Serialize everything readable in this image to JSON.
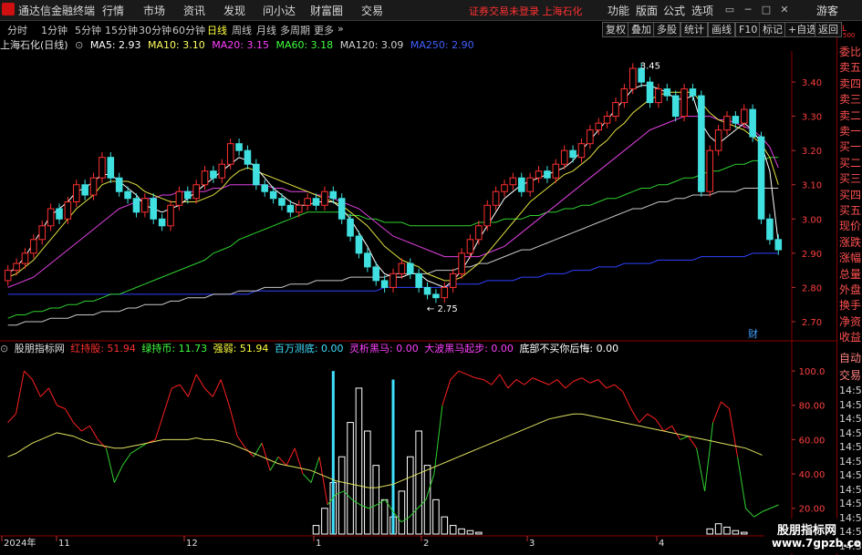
{
  "app": {
    "title": "通达信金融终端"
  },
  "menu": [
    "行情",
    "市场",
    "资讯",
    "发现",
    "问小达",
    "财富圈",
    "交易"
  ],
  "notice": "证券交易未登录  上海石化",
  "right_menu": [
    "功能",
    "版面",
    "公式",
    "选项"
  ],
  "guest": "游客",
  "window_buttons": [
    "▭",
    "─",
    "□",
    "✕"
  ],
  "periods": [
    "分时",
    "1分钟",
    "5分钟",
    "15分钟",
    "30分钟",
    "60分钟",
    "日线",
    "周线",
    "月线",
    "多周期",
    "更多"
  ],
  "active_period": "日线",
  "toolbar": [
    "复权",
    "叠加",
    "多股",
    "统计",
    "画线",
    "F10",
    "标记",
    "+自选",
    "返回"
  ],
  "stock_title": "上海石化(日线)",
  "ma_legend": [
    {
      "label": "MA5: 2.93",
      "color": "#ffffff"
    },
    {
      "label": "MA10: 3.10",
      "color": "#ffff60"
    },
    {
      "label": "MA20: 3.15",
      "color": "#ff40ff"
    },
    {
      "label": "MA60: 3.18",
      "color": "#40ff40"
    },
    {
      "label": "MA120: 3.09",
      "color": "#d0d0d0"
    },
    {
      "label": "MA250: 2.90",
      "color": "#4060ff"
    }
  ],
  "right_panel": [
    "委比",
    "卖五",
    "卖四",
    "卖三",
    "卖二",
    "卖一",
    "买一",
    "买二",
    "买三",
    "买四",
    "买五",
    "现价",
    "涨跌",
    "涨幅",
    "总量",
    "外盘",
    "换手",
    "净资",
    "收益"
  ],
  "right_panel_bottom": [
    "自动",
    "交易"
  ],
  "time_labels": [
    "14:56",
    "14:56",
    "14:56",
    "14:56",
    "14:56",
    "14:56",
    "14:56",
    "14:56",
    "14:56",
    "14:56",
    "14:56",
    "14:56"
  ],
  "badge": "财",
  "mini_mark": [
    "L",
    "500"
  ],
  "indicator": {
    "name": "股朋指标网",
    "items": [
      {
        "label": "红持股: 51.94",
        "color": "#ff3030"
      },
      {
        "label": "绿持币: 11.73",
        "color": "#40ff40"
      },
      {
        "label": "强弱: 51.94",
        "color": "#ffff40"
      },
      {
        "label": "百万测底: 0.00",
        "color": "#40e0ff"
      },
      {
        "label": "灵析黑马: 0.00",
        "color": "#ff40ff"
      },
      {
        "label": "大波黑马起步: 0.00",
        "color": "#ff40ff"
      },
      {
        "label": "底部不买你后悔: 0.00",
        "color": "#ffffff"
      }
    ]
  },
  "xaxis_labels": [
    "2024年",
    "11",
    "12",
    "1",
    "2",
    "3",
    "4"
  ],
  "watermark": {
    "line1": "股朋指标网",
    "line2": "www.7gpzb.com"
  },
  "chart_data": [
    {
      "type": "candlestick",
      "title": "上海石化(日线)",
      "y_ticks": [
        3.4,
        3.3,
        3.2,
        3.1,
        3.0,
        2.9,
        2.8,
        2.7
      ],
      "ylim": [
        2.66,
        3.48
      ],
      "annotations": [
        {
          "label": "3.45",
          "value": 3.45
        },
        {
          "label": "2.75",
          "value": 2.75
        }
      ],
      "close": [
        2.85,
        2.87,
        2.9,
        2.94,
        2.98,
        3.03,
        3.0,
        3.05,
        3.1,
        3.07,
        3.12,
        3.18,
        3.12,
        3.08,
        3.06,
        3.02,
        3.06,
        3.0,
        2.98,
        3.04,
        3.08,
        3.06,
        3.1,
        3.14,
        3.12,
        3.16,
        3.22,
        3.2,
        3.16,
        3.1,
        3.08,
        3.06,
        3.04,
        3.02,
        3.04,
        3.06,
        3.04,
        3.08,
        3.06,
        3.0,
        2.95,
        2.9,
        2.86,
        2.82,
        2.8,
        2.84,
        2.87,
        2.84,
        2.8,
        2.78,
        2.77,
        2.8,
        2.84,
        2.9,
        2.94,
        2.98,
        3.04,
        3.08,
        3.1,
        3.12,
        3.08,
        3.12,
        3.14,
        3.12,
        3.16,
        3.2,
        3.18,
        3.22,
        3.26,
        3.28,
        3.3,
        3.34,
        3.38,
        3.44,
        3.4,
        3.34,
        3.38,
        3.36,
        3.3,
        3.38,
        3.36,
        3.08,
        3.2,
        3.26,
        3.3,
        3.28,
        3.32,
        3.24,
        3.0,
        2.94,
        2.91
      ],
      "ma5": [
        2.84,
        2.86,
        2.89,
        2.93,
        2.97,
        3.01,
        3.03,
        3.05,
        3.08,
        3.09,
        3.11,
        3.13,
        3.13,
        3.11,
        3.09,
        3.07,
        3.04,
        3.03,
        3.02,
        3.03,
        3.04,
        3.06,
        3.08,
        3.1,
        3.12,
        3.14,
        3.16,
        3.18,
        3.17,
        3.15,
        3.12,
        3.09,
        3.07,
        3.05,
        3.04,
        3.04,
        3.05,
        3.05,
        3.05,
        3.03,
        3.0,
        2.96,
        2.92,
        2.87,
        2.84,
        2.83,
        2.83,
        2.84,
        2.84,
        2.82,
        2.81,
        2.8,
        2.82,
        2.85,
        2.89,
        2.94,
        2.98,
        3.02,
        3.06,
        3.08,
        3.1,
        3.11,
        3.12,
        3.13,
        3.14,
        3.15,
        3.17,
        3.2,
        3.23,
        3.26,
        3.29,
        3.32,
        3.35,
        3.38,
        3.39,
        3.39,
        3.38,
        3.37,
        3.35,
        3.35,
        3.36,
        3.28,
        3.24,
        3.22,
        3.24,
        3.26,
        3.28,
        3.26,
        3.22,
        3.14,
        2.93
      ],
      "ma10": [
        2.83,
        2.84,
        2.86,
        2.88,
        2.91,
        2.94,
        2.97,
        3.0,
        3.03,
        3.05,
        3.07,
        3.1,
        3.11,
        3.11,
        3.11,
        3.1,
        3.08,
        3.07,
        3.06,
        3.05,
        3.05,
        3.05,
        3.05,
        3.06,
        3.07,
        3.09,
        3.12,
        3.14,
        3.15,
        3.14,
        3.13,
        3.12,
        3.11,
        3.1,
        3.09,
        3.08,
        3.07,
        3.06,
        3.05,
        3.04,
        3.02,
        3.0,
        2.98,
        2.95,
        2.92,
        2.9,
        2.88,
        2.87,
        2.86,
        2.84,
        2.83,
        2.82,
        2.82,
        2.83,
        2.85,
        2.87,
        2.9,
        2.93,
        2.96,
        2.99,
        3.02,
        3.05,
        3.07,
        3.09,
        3.11,
        3.13,
        3.14,
        3.16,
        3.18,
        3.21,
        3.23,
        3.26,
        3.28,
        3.31,
        3.33,
        3.35,
        3.36,
        3.37,
        3.37,
        3.37,
        3.37,
        3.34,
        3.31,
        3.29,
        3.28,
        3.27,
        3.26,
        3.24,
        3.22,
        3.18,
        3.1
      ],
      "ma20": [
        2.8,
        2.81,
        2.82,
        2.83,
        2.85,
        2.87,
        2.89,
        2.91,
        2.93,
        2.95,
        2.97,
        2.99,
        3.01,
        3.03,
        3.04,
        3.05,
        3.06,
        3.06,
        3.07,
        3.07,
        3.08,
        3.08,
        3.08,
        3.08,
        3.09,
        3.09,
        3.1,
        3.1,
        3.1,
        3.1,
        3.1,
        3.09,
        3.09,
        3.08,
        3.08,
        3.08,
        3.07,
        3.07,
        3.06,
        3.05,
        3.04,
        3.03,
        3.01,
        2.99,
        2.97,
        2.95,
        2.94,
        2.93,
        2.92,
        2.91,
        2.9,
        2.89,
        2.89,
        2.89,
        2.89,
        2.89,
        2.9,
        2.91,
        2.92,
        2.94,
        2.96,
        2.98,
        3.0,
        3.02,
        3.04,
        3.06,
        3.08,
        3.1,
        3.12,
        3.14,
        3.16,
        3.18,
        3.2,
        3.22,
        3.24,
        3.26,
        3.27,
        3.28,
        3.29,
        3.3,
        3.3,
        3.3,
        3.3,
        3.29,
        3.29,
        3.28,
        3.27,
        3.26,
        3.24,
        3.21,
        3.15
      ],
      "ma60": [
        2.71,
        2.72,
        2.72,
        2.73,
        2.73,
        2.74,
        2.74,
        2.75,
        2.75,
        2.76,
        2.76,
        2.77,
        2.78,
        2.78,
        2.79,
        2.8,
        2.81,
        2.82,
        2.83,
        2.84,
        2.85,
        2.86,
        2.87,
        2.88,
        2.9,
        2.91,
        2.92,
        2.94,
        2.95,
        2.96,
        2.97,
        2.98,
        2.99,
        3.0,
        3.01,
        3.02,
        3.02,
        3.02,
        3.02,
        3.02,
        3.01,
        3.01,
        3.0,
        3.0,
        2.99,
        2.99,
        2.99,
        2.98,
        2.98,
        2.98,
        2.98,
        2.98,
        2.98,
        2.98,
        2.98,
        2.99,
        2.99,
        2.99,
        3.0,
        3.0,
        3.0,
        3.01,
        3.01,
        3.02,
        3.02,
        3.03,
        3.03,
        3.04,
        3.04,
        3.05,
        3.06,
        3.06,
        3.07,
        3.08,
        3.09,
        3.09,
        3.1,
        3.1,
        3.11,
        3.12,
        3.12,
        3.13,
        3.14,
        3.14,
        3.15,
        3.16,
        3.16,
        3.17,
        3.17,
        3.18,
        3.18
      ],
      "ma120": [
        2.69,
        2.69,
        2.7,
        2.7,
        2.7,
        2.71,
        2.71,
        2.71,
        2.72,
        2.72,
        2.72,
        2.73,
        2.73,
        2.73,
        2.74,
        2.74,
        2.75,
        2.75,
        2.75,
        2.76,
        2.76,
        2.77,
        2.77,
        2.77,
        2.78,
        2.78,
        2.78,
        2.79,
        2.79,
        2.79,
        2.8,
        2.8,
        2.8,
        2.81,
        2.81,
        2.81,
        2.82,
        2.82,
        2.82,
        2.82,
        2.83,
        2.83,
        2.83,
        2.83,
        2.83,
        2.84,
        2.84,
        2.84,
        2.84,
        2.84,
        2.85,
        2.85,
        2.85,
        2.86,
        2.86,
        2.87,
        2.87,
        2.88,
        2.89,
        2.9,
        2.91,
        2.91,
        2.92,
        2.93,
        2.94,
        2.95,
        2.96,
        2.97,
        2.98,
        2.99,
        3.0,
        3.01,
        3.02,
        3.03,
        3.03,
        3.04,
        3.05,
        3.05,
        3.06,
        3.06,
        3.07,
        3.07,
        3.07,
        3.08,
        3.08,
        3.08,
        3.09,
        3.09,
        3.09,
        3.09,
        3.09
      ],
      "ma250": [
        2.78,
        2.78,
        2.78,
        2.78,
        2.78,
        2.78,
        2.78,
        2.78,
        2.78,
        2.78,
        2.78,
        2.78,
        2.78,
        2.78,
        2.78,
        2.78,
        2.78,
        2.78,
        2.78,
        2.78,
        2.78,
        2.78,
        2.78,
        2.78,
        2.78,
        2.78,
        2.78,
        2.78,
        2.78,
        2.79,
        2.79,
        2.79,
        2.79,
        2.79,
        2.79,
        2.79,
        2.79,
        2.79,
        2.79,
        2.79,
        2.79,
        2.79,
        2.79,
        2.79,
        2.8,
        2.8,
        2.8,
        2.8,
        2.8,
        2.8,
        2.8,
        2.8,
        2.81,
        2.81,
        2.81,
        2.81,
        2.82,
        2.82,
        2.82,
        2.82,
        2.83,
        2.83,
        2.83,
        2.84,
        2.84,
        2.84,
        2.85,
        2.85,
        2.85,
        2.86,
        2.86,
        2.86,
        2.87,
        2.87,
        2.87,
        2.87,
        2.88,
        2.88,
        2.88,
        2.88,
        2.88,
        2.89,
        2.89,
        2.89,
        2.89,
        2.89,
        2.89,
        2.9,
        2.9,
        2.9,
        2.9
      ]
    },
    {
      "type": "line",
      "title": "股朋指标网",
      "y_ticks": [
        100.0,
        80.0,
        60.0,
        40.0,
        20.0
      ],
      "ylim": [
        5,
        108
      ],
      "red_green": [
        70,
        75,
        100,
        95,
        85,
        90,
        80,
        78,
        70,
        65,
        68,
        60,
        55,
        35,
        45,
        52,
        55,
        58,
        60,
        75,
        90,
        92,
        85,
        98,
        90,
        85,
        95,
        80,
        62,
        55,
        50,
        58,
        42,
        50,
        45,
        55,
        40,
        35,
        50,
        22,
        28,
        30,
        25,
        22,
        20,
        22,
        25,
        18,
        12,
        15,
        20,
        25,
        40,
        80,
        95,
        100,
        98,
        96,
        95,
        92,
        98,
        90,
        95,
        92,
        96,
        94,
        92,
        95,
        90,
        94,
        96,
        93,
        95,
        90,
        92,
        88,
        78,
        70,
        75,
        72,
        65,
        68,
        60,
        62,
        55,
        30,
        70,
        82,
        78,
        50,
        20,
        15,
        18,
        20,
        22
      ],
      "strength": [
        50,
        52,
        55,
        58,
        60,
        62,
        64,
        63,
        62,
        60,
        58,
        57,
        56,
        55,
        55,
        56,
        57,
        58,
        59,
        60,
        60,
        60,
        60,
        61,
        60,
        60,
        59,
        58,
        56,
        54,
        52,
        50,
        48,
        46,
        45,
        44,
        43,
        42,
        40,
        38,
        36,
        35,
        34,
        33,
        32,
        32,
        33,
        34,
        36,
        38,
        40,
        42,
        44,
        46,
        48,
        50,
        52,
        54,
        56,
        58,
        60,
        62,
        64,
        66,
        68,
        70,
        72,
        73,
        74,
        75,
        75,
        74,
        73,
        72,
        71,
        70,
        69,
        68,
        67,
        66,
        65,
        64,
        63,
        62,
        61,
        60,
        59,
        58,
        57,
        56,
        55,
        53,
        51
      ],
      "bars": [
        0,
        0,
        0,
        0,
        0,
        0,
        0,
        0,
        0,
        0,
        0,
        0,
        0,
        0,
        0,
        0,
        0,
        0,
        0,
        0,
        0,
        0,
        0,
        0,
        0,
        0,
        0,
        0,
        0,
        0,
        0,
        0,
        0,
        0,
        0,
        0,
        5,
        15,
        30,
        45,
        65,
        85,
        60,
        40,
        20,
        10,
        25,
        45,
        60,
        40,
        20,
        10,
        5,
        3,
        2,
        1,
        0,
        0,
        0,
        0,
        0,
        0,
        0,
        0,
        0,
        0,
        0,
        0,
        0,
        0,
        0,
        0,
        0,
        0,
        0,
        0,
        0,
        0,
        0,
        0,
        0,
        0,
        3,
        6,
        4,
        2,
        1,
        0,
        0,
        5,
        8
      ]
    }
  ]
}
